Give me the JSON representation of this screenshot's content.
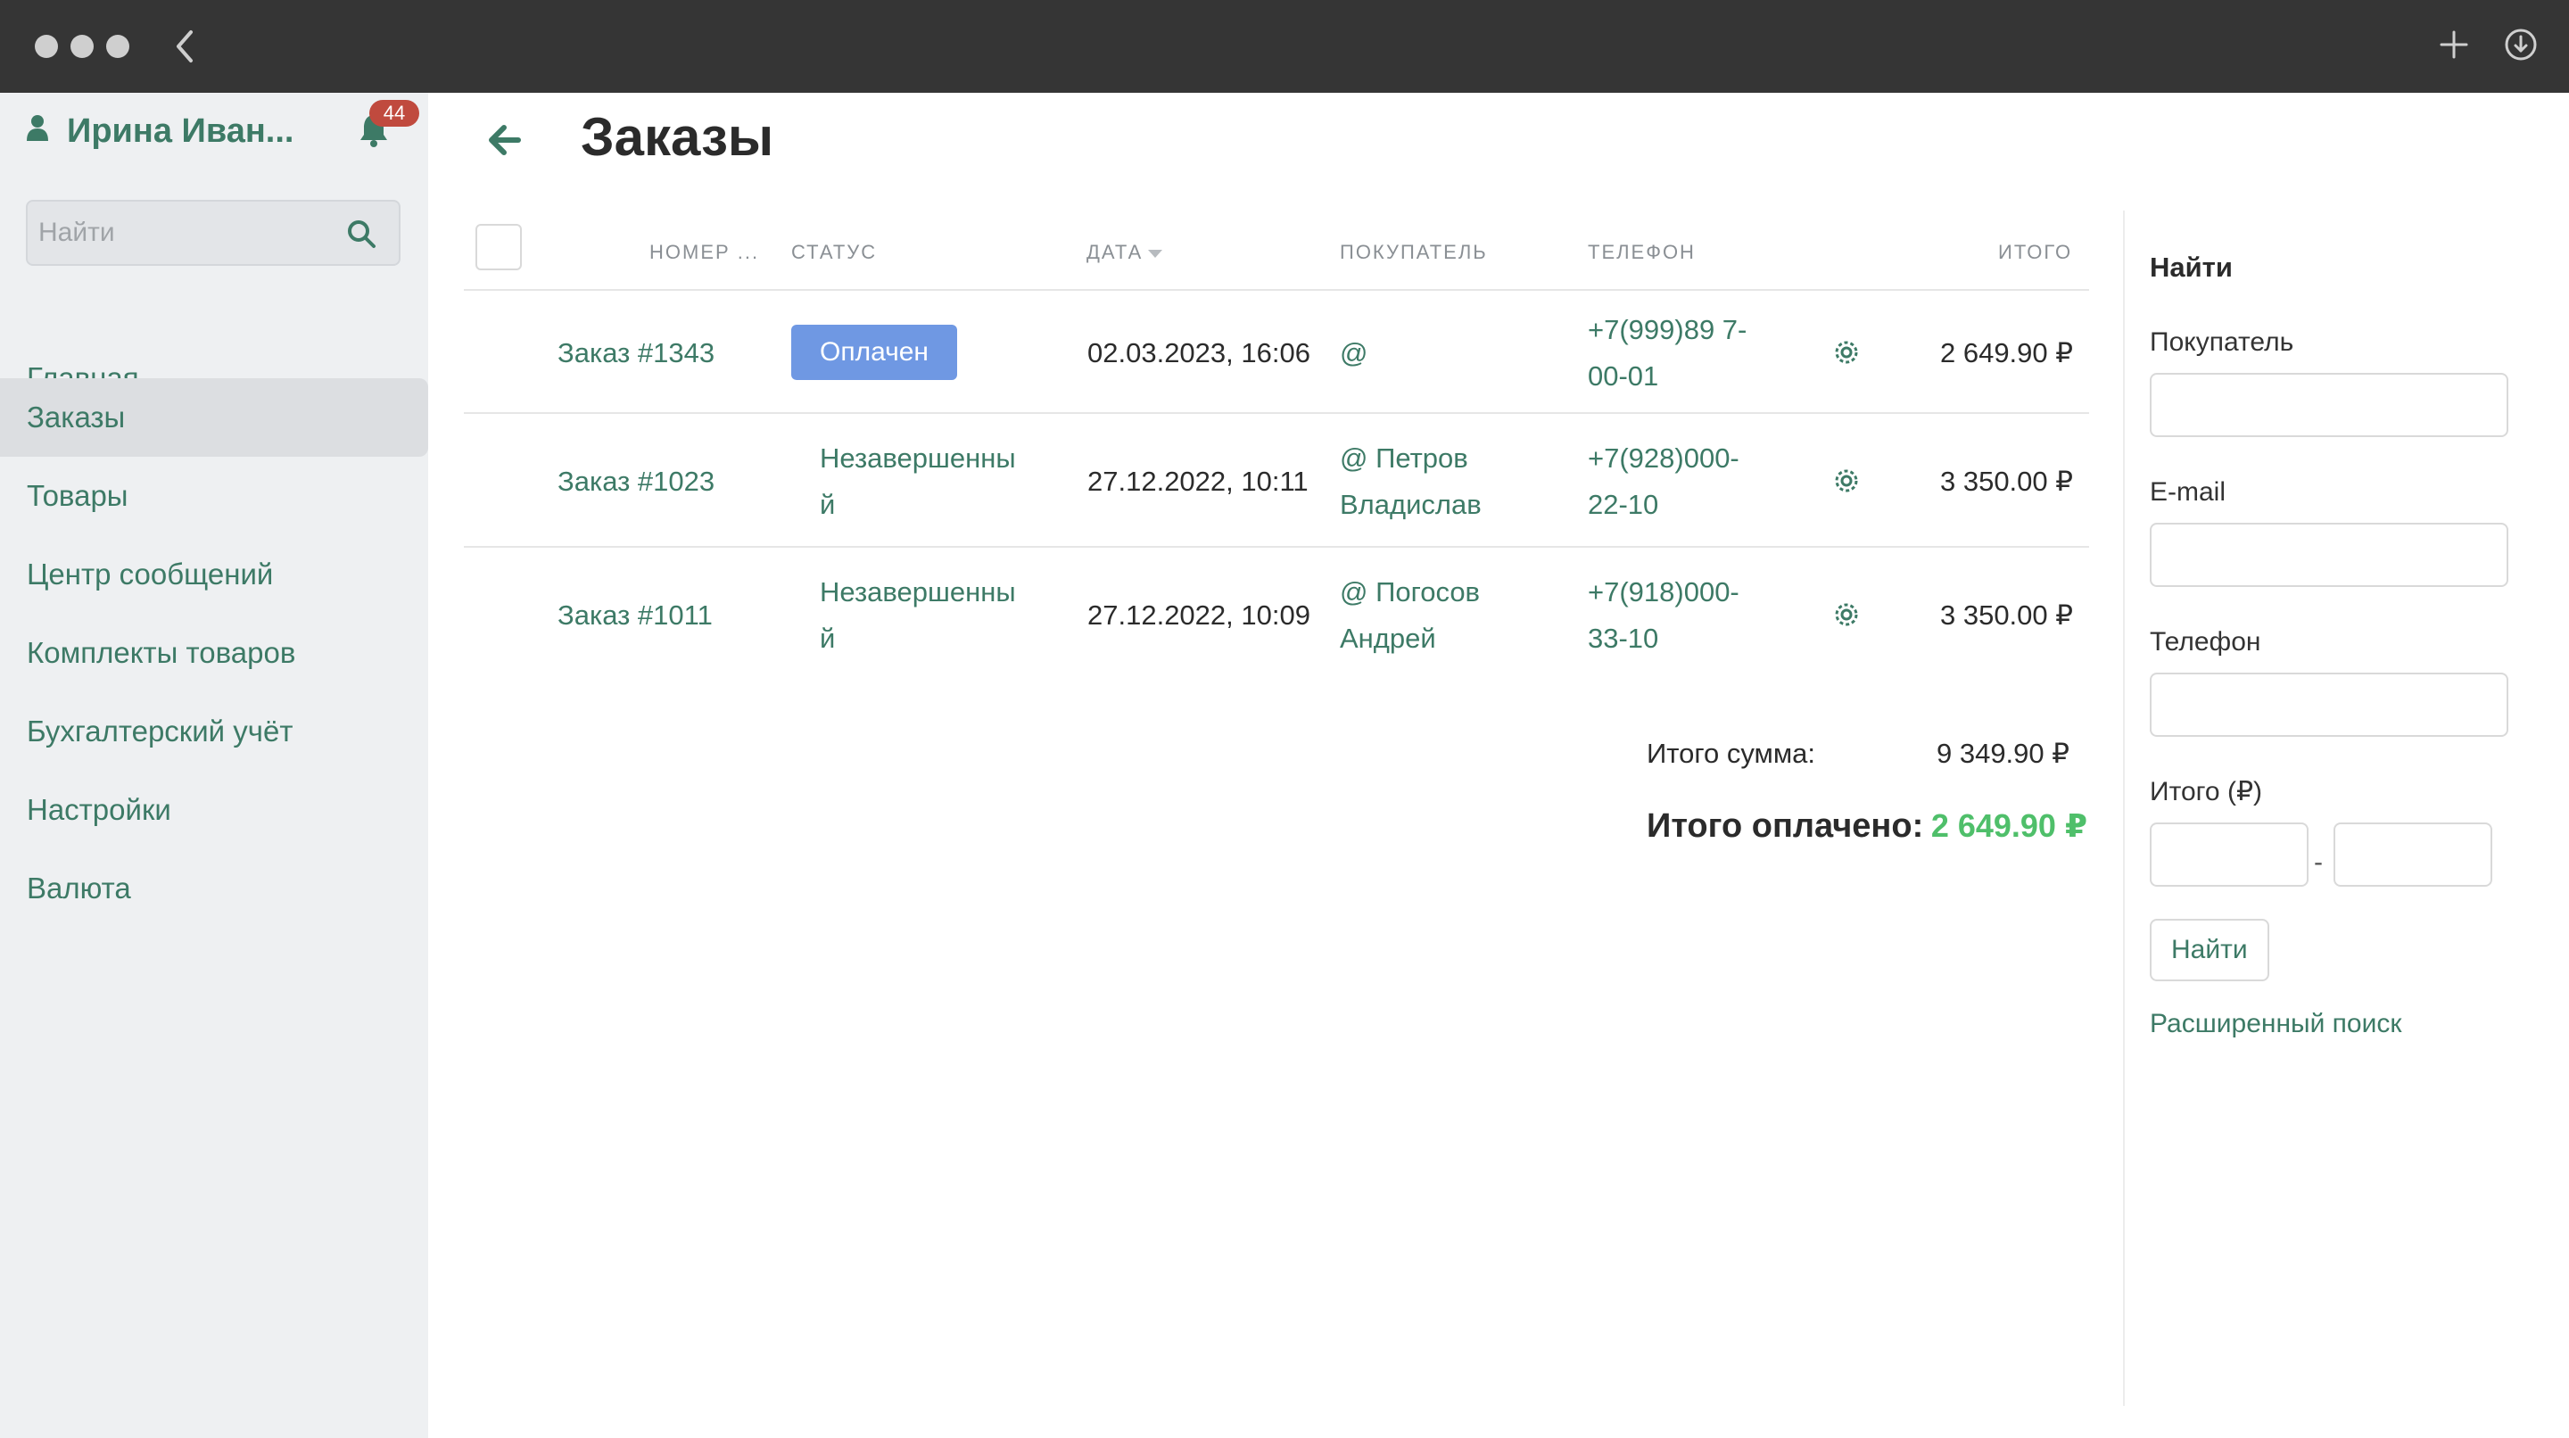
{
  "sidebar": {
    "user_name": "Ирина Иван...",
    "notification_count": "44",
    "search_placeholder": "Найти",
    "items": [
      {
        "label": "Главная"
      },
      {
        "label": "Заказы"
      },
      {
        "label": "Товары"
      },
      {
        "label": "Центр сообщений"
      },
      {
        "label": "Комплекты товаров"
      },
      {
        "label": "Бухгалтерский учёт"
      },
      {
        "label": "Настройки"
      },
      {
        "label": "Валюта"
      }
    ],
    "active_item": "Заказы"
  },
  "main": {
    "title": "Заказы",
    "columns": {
      "number": "НОМЕР ...",
      "status": "СТАТУС",
      "date": "ДАТА",
      "customer": "ПОКУПАТЕЛЬ",
      "phone": "ТЕЛЕФОН",
      "total": "ИТОГО"
    },
    "orders": [
      {
        "number": "Заказ #1343",
        "status": "Оплачен",
        "date": "02.03.2023, 16:06",
        "customer": "@",
        "phone": "+7(999)89 7-00-01",
        "total": "2 649.90 ₽"
      },
      {
        "number": "Заказ #1023",
        "status": "Незавершенный",
        "date": "27.12.2022, 10:11",
        "customer": "@ Петров Владислав",
        "phone": "+7(928)000-22-10",
        "total": "3 350.00 ₽"
      },
      {
        "number": "Заказ #1011",
        "status": "Незавершенный",
        "date": "27.12.2022, 10:09",
        "customer": "@ Погосов Андрей",
        "phone": "+7(918)000-33-10",
        "total": "3 350.00 ₽"
      }
    ],
    "summary": {
      "total_label": "Итого сумма:",
      "total_value": "9 349.90 ₽",
      "paid_label": "Итого оплачено:",
      "paid_value": "2 649.90 ₽"
    }
  },
  "filter": {
    "title": "Найти",
    "customer_label": "Покупатель",
    "email_label": "E-mail",
    "phone_label": "Телефон",
    "total_label": "Итого (₽)",
    "range_separator": "-",
    "find_button": "Найти",
    "advanced_link": "Расширенный поиск"
  },
  "colors": {
    "accent": "#3d7a66",
    "paid_badge": "#6f98e3",
    "paid_total": "#4fbf6a",
    "notification_badge": "#c04a3e",
    "titlebar": "#353535",
    "sidebar_bg": "#eef0f2"
  }
}
